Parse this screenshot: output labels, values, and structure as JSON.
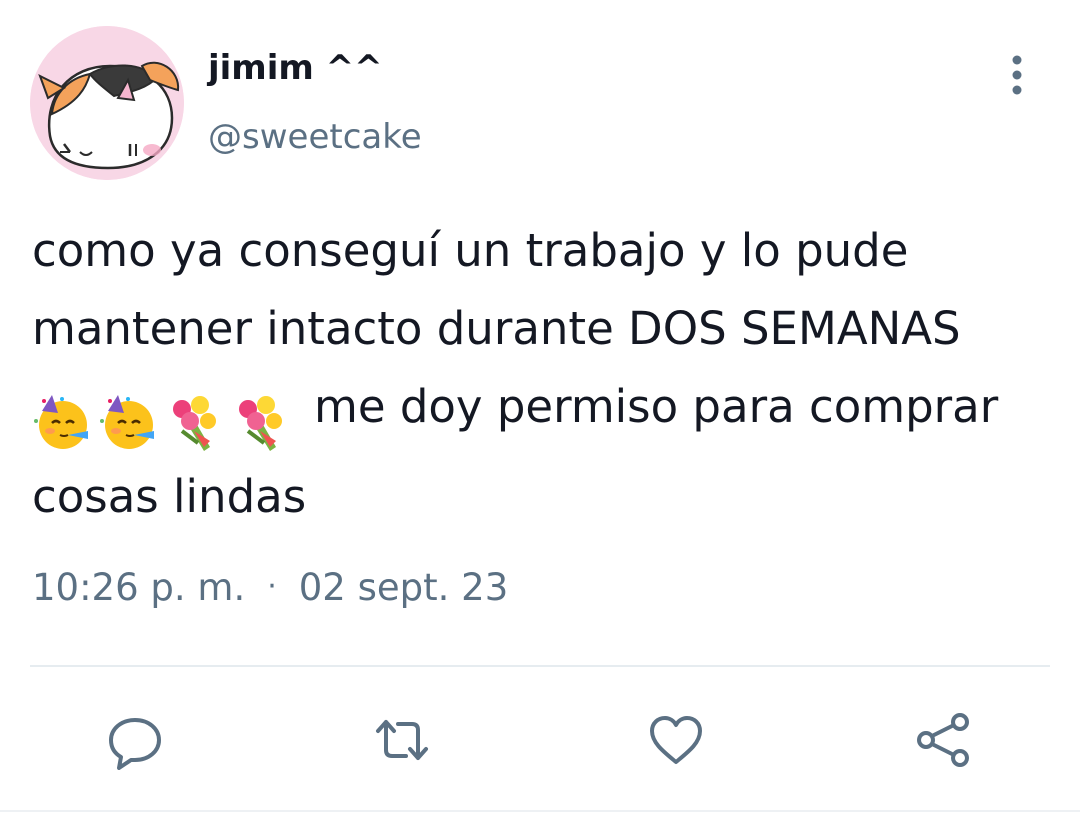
{
  "tweet": {
    "author": {
      "display_name": "jimim ^^",
      "handle": "@sweetcake",
      "avatar_icon": "calico-cat-drawing-avatar"
    },
    "menu_icon": "more-vertical-icon",
    "text": {
      "line1": "como ya conseguí un trabajo y lo pude",
      "line2": "mantener intacto durante DOS SEMANAS",
      "line3": "me doy permiso para comprar",
      "line4": "cosas lindas",
      "emojis": [
        "partying-face",
        "partying-face",
        "bouquet",
        "bouquet"
      ]
    },
    "time": "10:26 p. m.",
    "separator": "·",
    "date": "02 sept. 23",
    "actions": [
      {
        "name": "reply",
        "icon": "reply-icon"
      },
      {
        "name": "retweet",
        "icon": "retweet-icon"
      },
      {
        "name": "like",
        "icon": "heart-icon"
      },
      {
        "name": "share",
        "icon": "share-icon"
      }
    ]
  },
  "colors": {
    "text": "#141823",
    "secondary": "#5b7083",
    "divider": "#e6ecf0",
    "avatar_bg": "#f8d7e6"
  }
}
